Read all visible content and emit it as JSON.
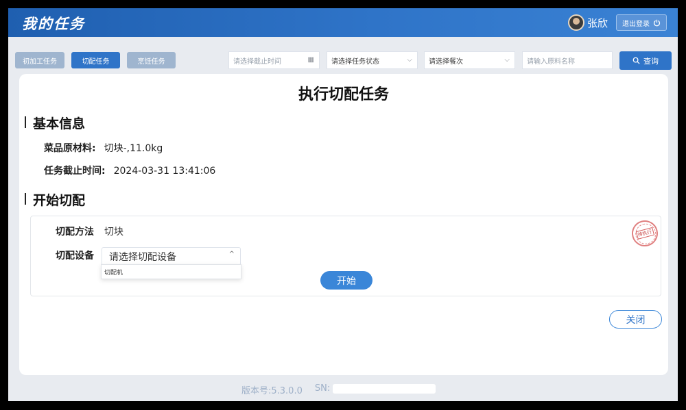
{
  "header": {
    "title": "我的任务",
    "user_name": "张欣",
    "logout_label": "退出登录"
  },
  "toolbar": {
    "tabs": [
      {
        "label": "初加工任务",
        "active": false
      },
      {
        "label": "切配任务",
        "active": true
      },
      {
        "label": "烹饪任务",
        "active": false
      }
    ],
    "deadline_placeholder": "请选择截止时间",
    "status_select": "请选择任务状态",
    "meal_select": "请选择餐次",
    "material_placeholder": "请输入原料名称",
    "search_label": "查询"
  },
  "main": {
    "title": "执行切配任务",
    "basic_info_title": "基本信息",
    "material_label": "菜品原材料:",
    "material_value": "切块-,11.0kg",
    "deadline_label": "任务截止时间:",
    "deadline_value": "2024-03-31 13:41:06",
    "start_section_title": "开始切配",
    "method_label": "切配方法",
    "method_value": "切块",
    "device_label": "切配设备",
    "device_placeholder": "请选择切配设备",
    "device_options": [
      "切配机"
    ],
    "start_label": "开始",
    "stamp_text": "待执行",
    "close_label": "关闭"
  },
  "footer": {
    "version": "版本号:5.3.0.0",
    "sn_label": "SN:"
  },
  "colors": {
    "primary": "#2f74c8",
    "header_start": "#1f5fb0",
    "tab_inactive": "#9fb5cf",
    "stamp": "#d66060"
  }
}
